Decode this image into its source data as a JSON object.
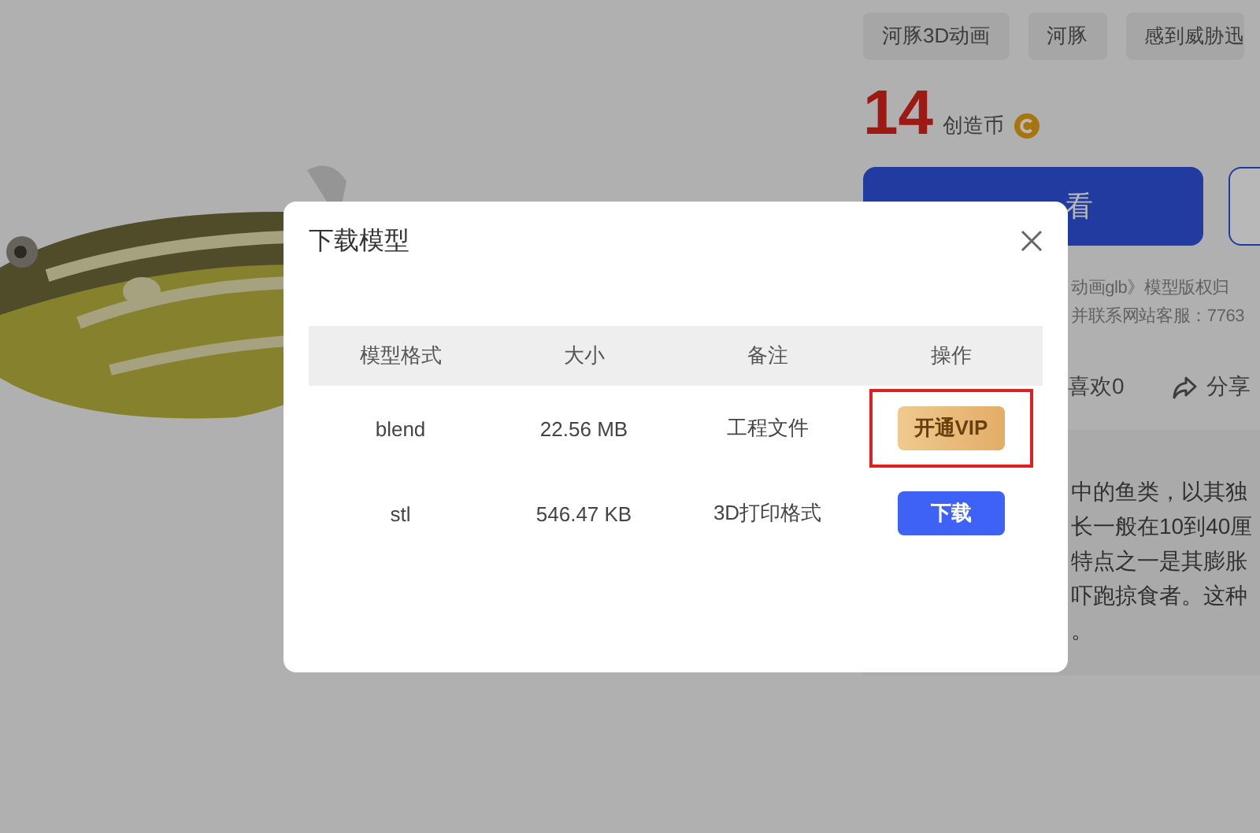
{
  "tags": [
    "河豚3D动画",
    "河豚",
    "感到威胁迅"
  ],
  "price": {
    "amount": "14",
    "unit": "创造币"
  },
  "primary_button": "看",
  "copyright_lines": [
    "动画glb》模型版权归",
    "并联系网站客服：7763"
  ],
  "actions": [
    {
      "kind": "like",
      "label": "喜欢0"
    },
    {
      "kind": "share",
      "label": "分享"
    }
  ],
  "description_lines": [
    "中的鱼类，以其独",
    "长一般在10到40厘",
    "特点之一是其膨胀",
    "吓跑掠食者。这种",
    "。"
  ],
  "dialog": {
    "title": "下载模型",
    "columns": [
      "模型格式",
      "大小",
      "备注",
      "操作"
    ],
    "rows": [
      {
        "format": "blend",
        "size": "22.56 MB",
        "note": "工程文件",
        "action": {
          "kind": "vip",
          "label": "开通VIP",
          "highlighted": true
        }
      },
      {
        "format": "stl",
        "size": "546.47 KB",
        "note": "3D打印格式",
        "action": {
          "kind": "download",
          "label": "下载",
          "highlighted": false
        }
      }
    ]
  }
}
